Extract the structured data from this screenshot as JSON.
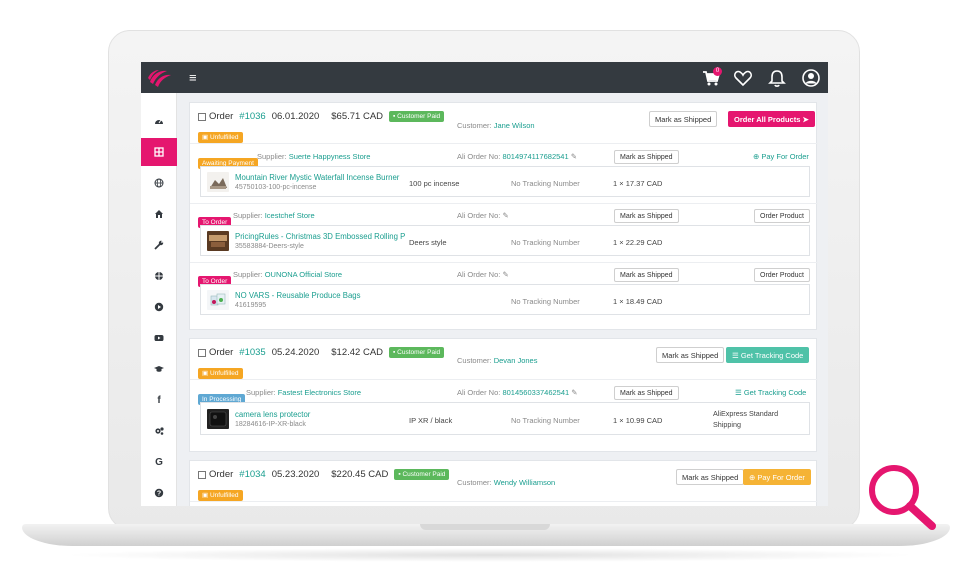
{
  "header": {
    "cart_count": "0"
  },
  "sidebar": {
    "items": [
      {
        "icon": "dashboard-icon"
      },
      {
        "icon": "orders-icon"
      },
      {
        "icon": "globe-icon"
      },
      {
        "icon": "home-icon"
      },
      {
        "icon": "wrench-icon"
      },
      {
        "icon": "crosshair-icon"
      },
      {
        "icon": "play-icon"
      },
      {
        "icon": "youtube-icon"
      },
      {
        "icon": "graduation-cap-icon"
      },
      {
        "icon": "facebook-icon",
        "text": "f"
      },
      {
        "icon": "cogs-icon"
      },
      {
        "icon": "google-icon",
        "text": "G"
      },
      {
        "icon": "help-icon"
      }
    ]
  },
  "orders": [
    {
      "prefix": "Order",
      "number": "#1036",
      "date": "06.01.2020",
      "total": "$65.71 CAD",
      "paid_badge": "Customer Paid",
      "status_badge": "Unfulfilled",
      "customer_label": "Customer:",
      "customer_name": "Jane Wilson",
      "mark_button": "Mark as Shipped",
      "action_button": "Order All Products",
      "suppliers": [
        {
          "status": "Awaiting Payment",
          "supplier_label": "Supplier:",
          "supplier_name": "Suerte Happyness Store",
          "ali_label": "Ali Order No:",
          "ali_number": "8014974117682541",
          "mark_button": "Mark as Shipped",
          "action": "Pay For Order",
          "product": {
            "name": "Mountain River Mystic Waterfall Incense Burner",
            "sku": "45750103-100-pc-incense",
            "variant": "100 pc incense",
            "tracking": "No Tracking Number",
            "qty": "1 × 17.37 CAD",
            "shipping": ""
          }
        },
        {
          "status": "To Order",
          "supplier_label": "Supplier:",
          "supplier_name": "Icestchef Store",
          "ali_label": "Ali Order No:",
          "ali_number": "",
          "mark_button": "Mark as Shipped",
          "action": "Order Product",
          "product": {
            "name": "PricingRules - Christmas 3D Embossed Rolling P",
            "sku": "35583884-Deers-style",
            "variant": "Deers style",
            "tracking": "No Tracking Number",
            "qty": "1 × 22.29 CAD",
            "shipping": ""
          }
        },
        {
          "status": "To Order",
          "supplier_label": "Supplier:",
          "supplier_name": "OUNONA Official Store",
          "ali_label": "Ali Order No:",
          "ali_number": "",
          "mark_button": "Mark as Shipped",
          "action": "Order Product",
          "product": {
            "name": "NO VARS - Reusable Produce Bags",
            "sku": "41619595",
            "variant": "",
            "tracking": "No Tracking Number",
            "qty": "1 × 18.49 CAD",
            "shipping": ""
          }
        }
      ]
    },
    {
      "prefix": "Order",
      "number": "#1035",
      "date": "05.24.2020",
      "total": "$12.42 CAD",
      "paid_badge": "Customer Paid",
      "status_badge": "Unfulfilled",
      "customer_label": "Customer:",
      "customer_name": "Devan Jones",
      "mark_button": "Mark as Shipped",
      "action_button": "Get Tracking Code",
      "suppliers": [
        {
          "status": "In Processing",
          "supplier_label": "Supplier:",
          "supplier_name": "Fastest Electronics Store",
          "ali_label": "Ali Order No:",
          "ali_number": "8014560337462541",
          "mark_button": "Mark as Shipped",
          "action": "Get Tracking Code",
          "product": {
            "name": "camera lens protector",
            "sku": "18284616-IP-XR-black",
            "variant": "IP XR / black",
            "tracking": "No Tracking Number",
            "qty": "1 × 10.99 CAD",
            "shipping": "AliExpress Standard Shipping"
          }
        }
      ]
    },
    {
      "prefix": "Order",
      "number": "#1034",
      "date": "05.23.2020",
      "total": "$220.45 CAD",
      "paid_badge": "Customer Paid",
      "status_badge": "Unfulfilled",
      "customer_label": "Customer:",
      "customer_name": "Wendy Williamson",
      "mark_button": "Mark as Shipped",
      "action_button": "Pay For Order"
    }
  ],
  "colors": {
    "accent": "#e5166f",
    "link": "#1a9e8f",
    "topbar": "#343a40",
    "paid": "#5cb85c",
    "unfulfilled": "#f5a623",
    "processing": "#5fa8d3",
    "tracking_button": "#4fc2a8"
  }
}
